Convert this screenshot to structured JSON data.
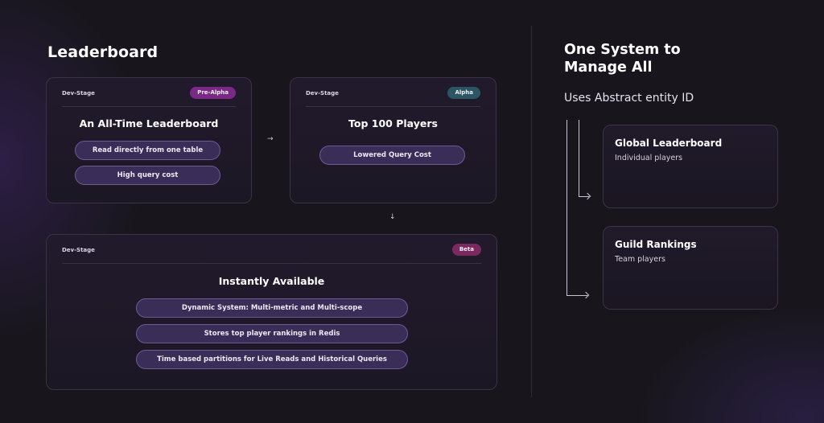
{
  "leaderboard": {
    "title": "Leaderboard",
    "cards": [
      {
        "stage_label": "Dev-Stage",
        "badge": "Pre-Alpha",
        "badge_color": "#7a2a86",
        "title": "An All-Time Leaderboard",
        "items": [
          "Read directly from one table",
          "High query cost"
        ]
      },
      {
        "stage_label": "Dev-Stage",
        "badge": "Alpha",
        "badge_color": "#2b5563",
        "title": "Top 100 Players",
        "items": [
          "Lowered Query Cost"
        ]
      },
      {
        "stage_label": "Dev-Stage",
        "badge": "Beta",
        "badge_color": "#7a2a5e",
        "title": "Instantly Available",
        "items": [
          "Dynamic System: Multi-metric and Multi-scope",
          "Stores top player rankings in Redis",
          "Time based partitions for Live Reads and Historical Queries"
        ]
      }
    ],
    "arrows": {
      "right": "→",
      "down": "↓"
    }
  },
  "system": {
    "title_line1": "One System to",
    "title_line2": "Manage All",
    "subtitle": "Uses Abstract entity ID",
    "cards": [
      {
        "title": "Global Leaderboard",
        "subtitle": "Individual players"
      },
      {
        "title": "Guild Rankings",
        "subtitle": "Team players"
      }
    ]
  },
  "colors": {
    "background": "#18161c",
    "card_border": "#3b3246",
    "pill_fill": "#3a2d58",
    "pill_border": "#6e5a94"
  }
}
